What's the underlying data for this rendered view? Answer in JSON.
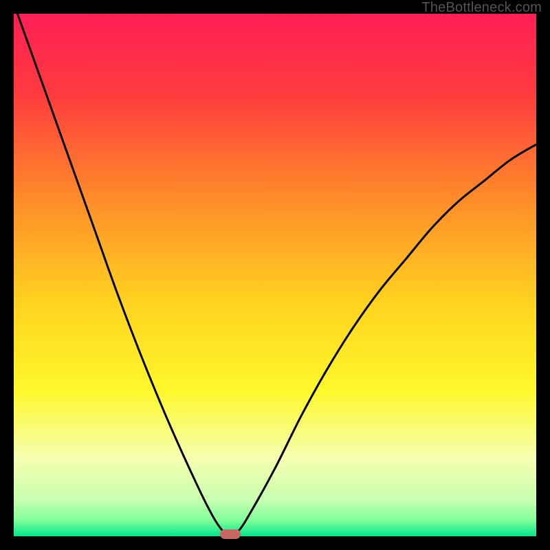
{
  "watermark": "TheBottleneck.com",
  "chart_data": {
    "type": "line",
    "title": "",
    "xlabel": "",
    "ylabel": "",
    "xlim": [
      0,
      100
    ],
    "ylim": [
      0,
      100
    ],
    "grid": false,
    "legend": false,
    "gradient_stops": [
      {
        "offset": 0.0,
        "color": "#ff1f54"
      },
      {
        "offset": 0.15,
        "color": "#ff3a3f"
      },
      {
        "offset": 0.35,
        "color": "#ff8a2a"
      },
      {
        "offset": 0.55,
        "color": "#ffd21f"
      },
      {
        "offset": 0.72,
        "color": "#fff82a"
      },
      {
        "offset": 0.85,
        "color": "#f6ffb0"
      },
      {
        "offset": 0.93,
        "color": "#c8ffb0"
      },
      {
        "offset": 0.97,
        "color": "#7fff9a"
      },
      {
        "offset": 1.0,
        "color": "#00e58a"
      }
    ],
    "series": [
      {
        "name": "bottleneck-curve",
        "x": [
          0,
          5,
          10,
          15,
          20,
          25,
          30,
          35,
          38,
          40,
          41.5,
          43,
          45,
          50,
          55,
          60,
          65,
          70,
          75,
          80,
          85,
          90,
          95,
          100
        ],
        "y": [
          102,
          88,
          74,
          60,
          46,
          33,
          21,
          10,
          4,
          1,
          0,
          1,
          4,
          13,
          23,
          32,
          40,
          47,
          53,
          59,
          64,
          68,
          72,
          75
        ]
      }
    ],
    "marker": {
      "x": 41.5,
      "y": 0,
      "color": "#c76760"
    }
  }
}
